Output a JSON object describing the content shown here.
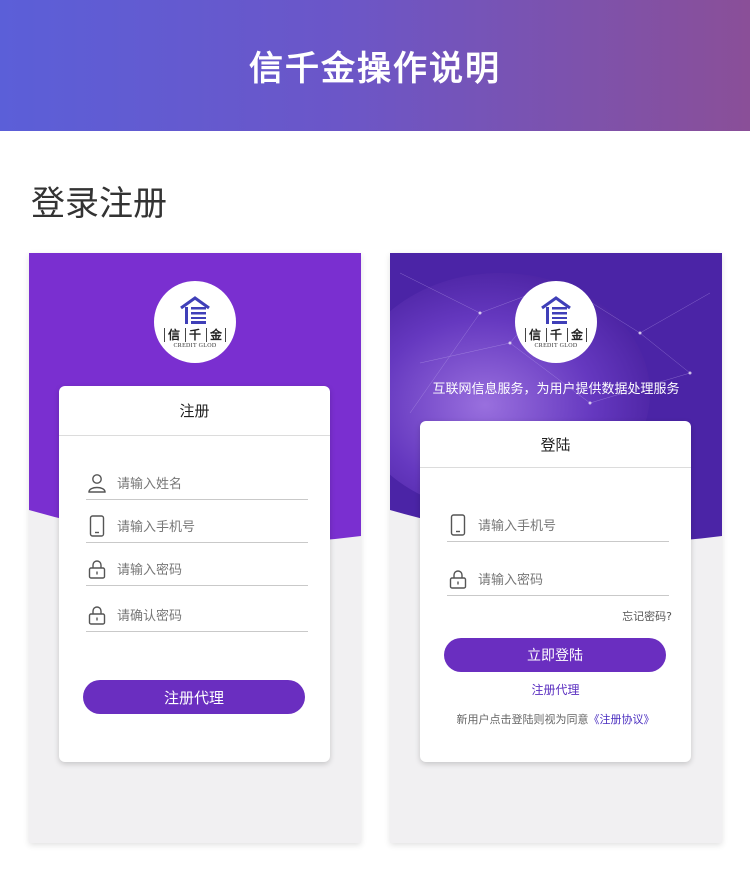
{
  "banner": {
    "title": "信千金操作说明"
  },
  "section": {
    "title": "登录注册"
  },
  "logo": {
    "chars": [
      "信",
      "千",
      "金"
    ],
    "subtitle": "CREDIT GLOD"
  },
  "register": {
    "title": "注册",
    "fields": [
      {
        "icon": "user-icon",
        "placeholder": "请输入姓名"
      },
      {
        "icon": "phone-icon",
        "placeholder": "请输入手机号"
      },
      {
        "icon": "lock-icon",
        "placeholder": "请输入密码"
      },
      {
        "icon": "lock-icon",
        "placeholder": "请确认密码"
      }
    ],
    "button_label": "注册代理"
  },
  "login": {
    "tagline": "互联网信息服务，为用户提供数据处理服务",
    "title": "登陆",
    "fields": [
      {
        "icon": "phone-icon",
        "placeholder": "请输入手机号"
      },
      {
        "icon": "lock-icon",
        "placeholder": "请输入密码"
      }
    ],
    "forgot_label": "忘记密码?",
    "button_label": "立即登陆",
    "register_link": "注册代理",
    "agreement_prefix": "新用户点击登陆则视为同意",
    "agreement_link": "《注册协议》"
  },
  "colors": {
    "accent": "#6a2ec0",
    "banner_start": "#5b5fd8",
    "banner_end": "#8a4f98",
    "phone_purple": "#7a2fd0"
  }
}
